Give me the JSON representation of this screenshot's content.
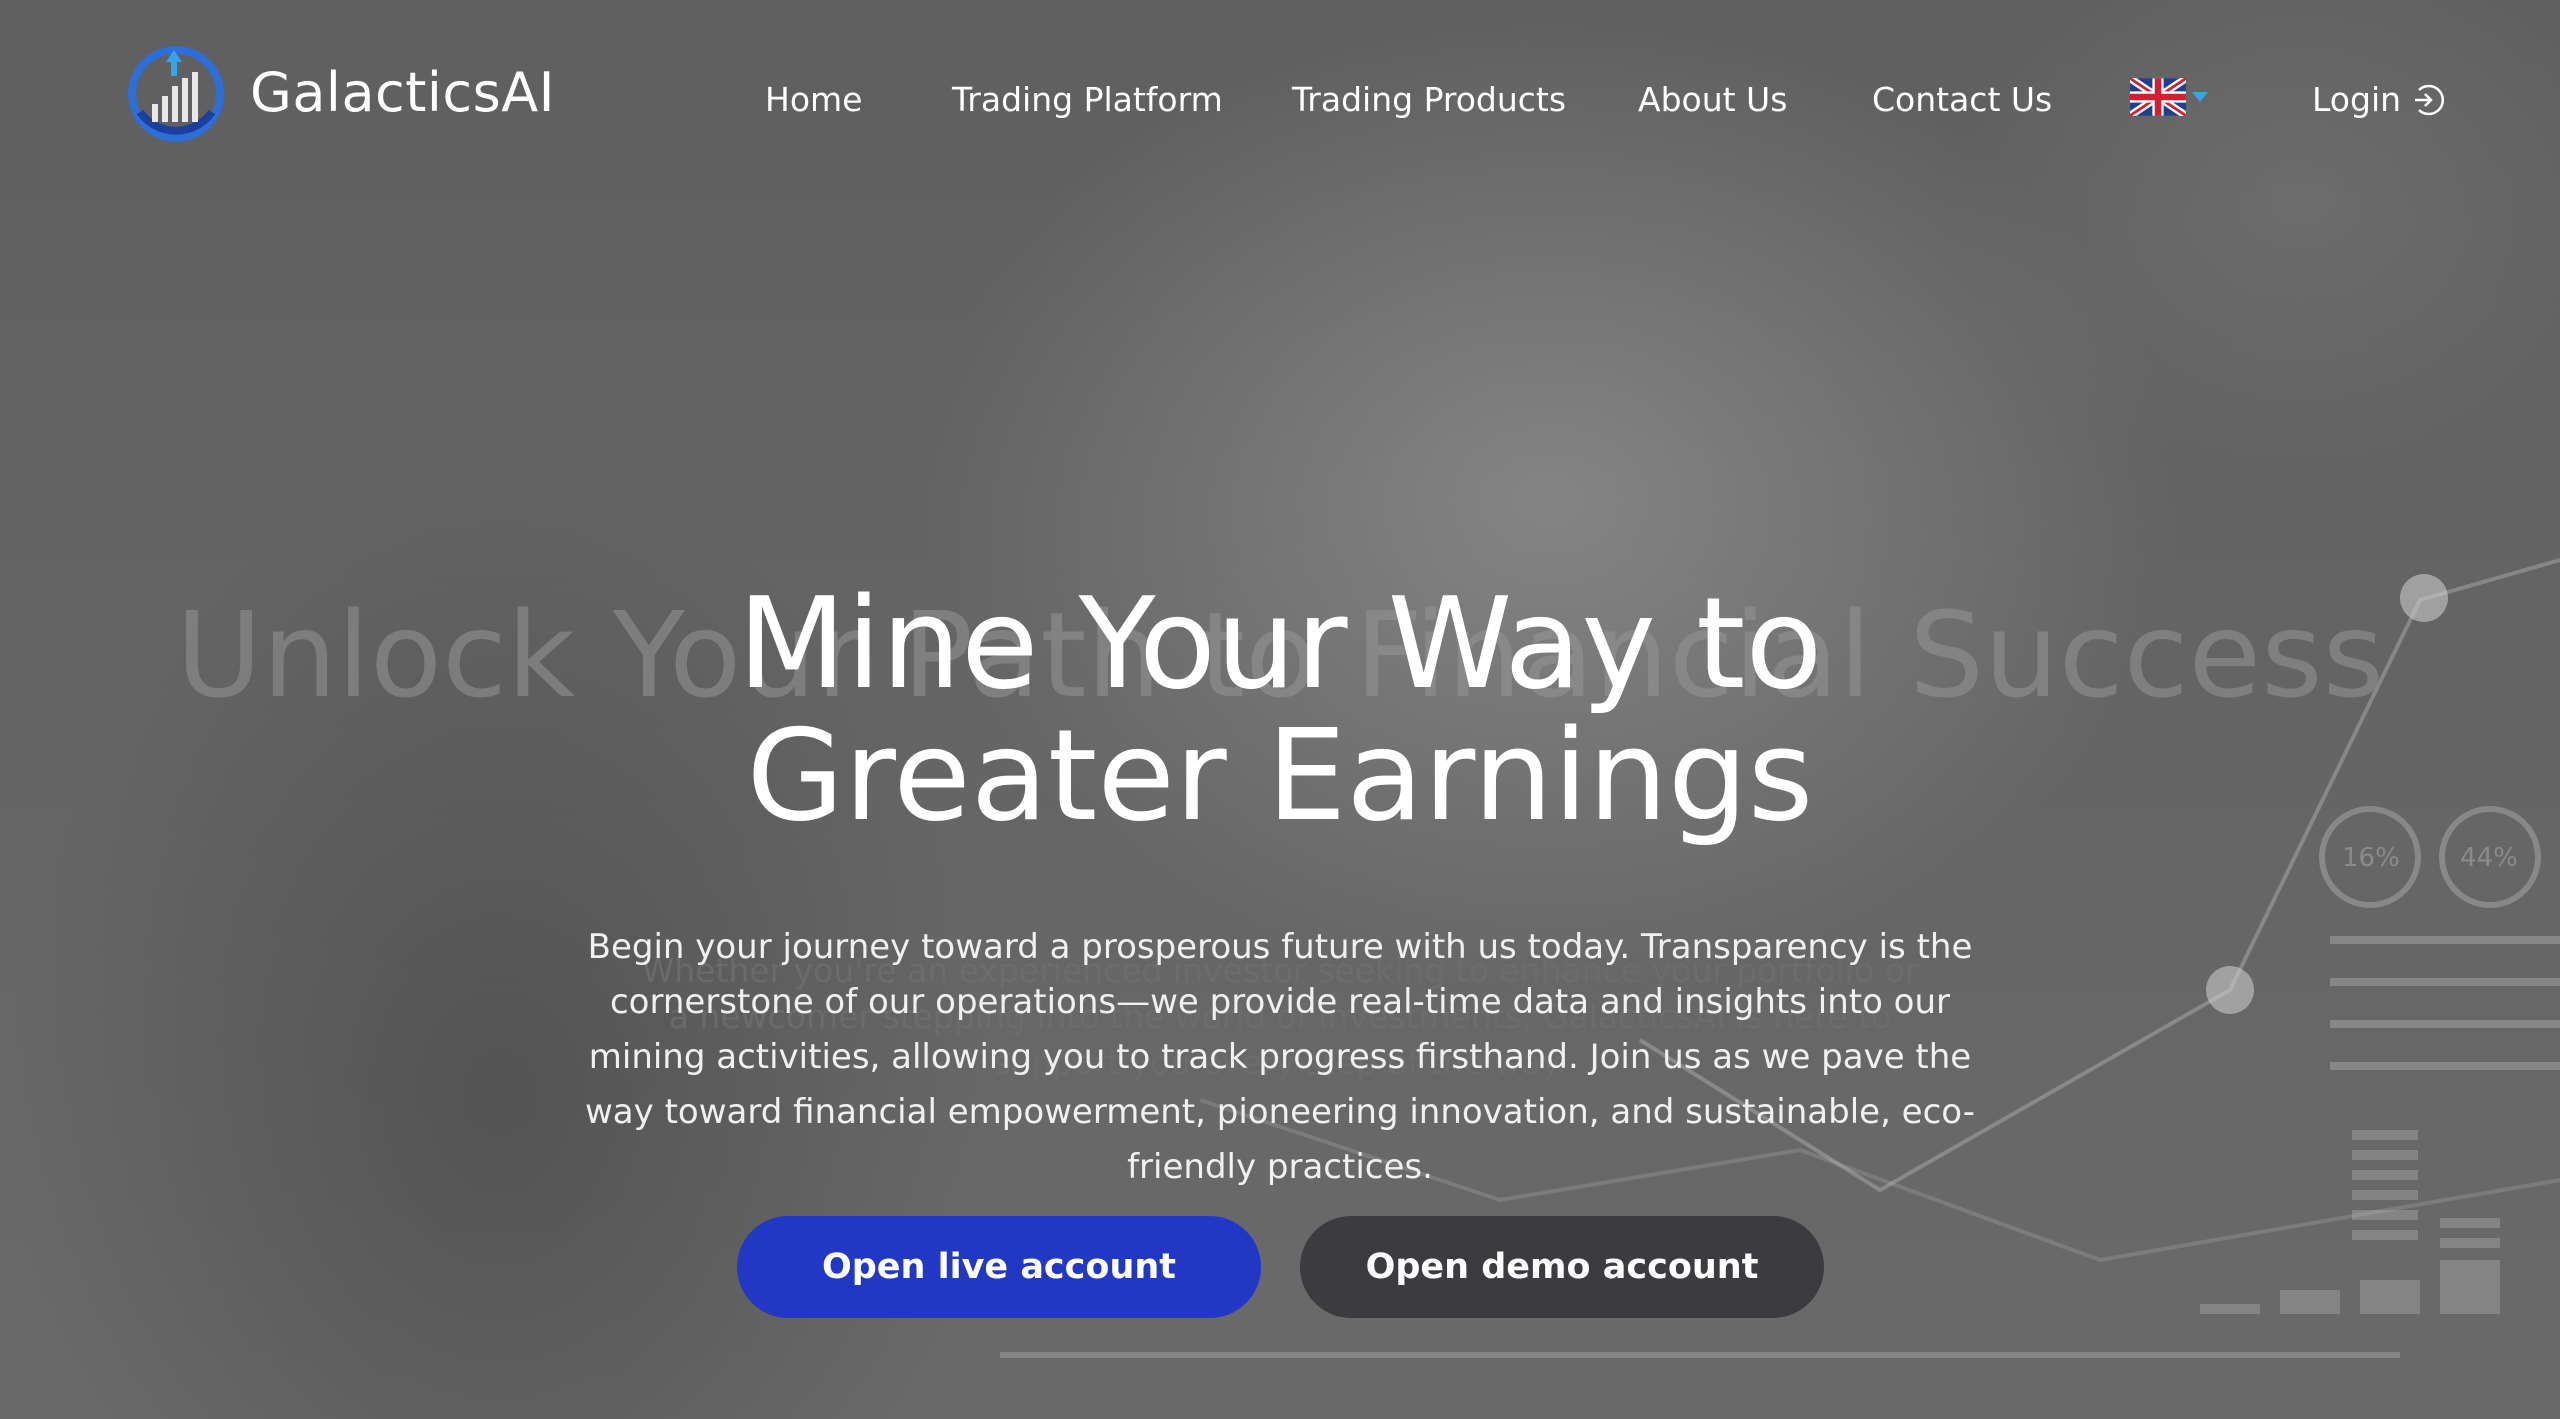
{
  "brand": {
    "name": "GalacticsAI"
  },
  "nav": {
    "items": [
      {
        "label": "Home"
      },
      {
        "label": "Trading Platform"
      },
      {
        "label": "Trading Products"
      },
      {
        "label": "About Us"
      },
      {
        "label": "Contact Us"
      }
    ],
    "language_icon": "uk-flag-icon",
    "login_label": "Login",
    "login_icon": "login-arrow-icon"
  },
  "hero": {
    "ghost_title": "Unlock Your Path to Financial Success",
    "title_line1": "Mine Your Way to",
    "title_line2": "Greater Earnings",
    "ghost_paragraph": "Whether you're an experienced investor seeking to enhance your portfolio or a newcomer stepping into the world of investments, GalacticsAI is here to support you every step of the way.",
    "paragraph": "Begin your journey toward a prosperous future with us today. Transparency is the cornerstone of our operations—we provide real-time data and insights into our mining activities, allowing you to track progress firsthand. Join us as we pave the way toward financial empowerment, pioneering innovation, and sustainable, eco-friendly practices.",
    "live_button": "Open live account",
    "demo_button": "Open demo account",
    "chart_gauges": [
      "16%",
      "44%"
    ]
  },
  "colors": {
    "live_button": "#2238c4",
    "demo_button": "#3b3b40",
    "accent": "#3aa3e6"
  }
}
